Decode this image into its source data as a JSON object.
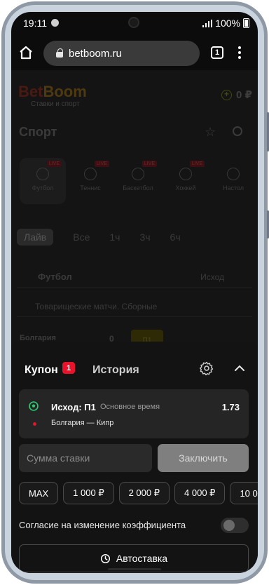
{
  "status_bar": {
    "time": "19:11",
    "battery": "100%"
  },
  "browser": {
    "url": "betboom.ru",
    "tab_count": "1"
  },
  "background_page": {
    "logo_bet": "Bet",
    "logo_boom": "Boom",
    "logo_tagline": "Ставки и спорт",
    "balance": "0 ₽",
    "section_title": "Спорт",
    "sports": [
      {
        "label": "Футбол",
        "live": "LIVE"
      },
      {
        "label": "Теннис",
        "live": "LIVE"
      },
      {
        "label": "Баскетбол",
        "live": "LIVE"
      },
      {
        "label": "Хоккей",
        "live": "LIVE"
      },
      {
        "label": "Настол"
      }
    ],
    "periods": [
      "Лайв",
      "Все",
      "1ч",
      "3ч",
      "6ч"
    ],
    "league_header": "Футбол",
    "market_select": "Исход",
    "league": "Товарищеские матчи. Сборные",
    "team": "Болгария",
    "score": "0",
    "odds_label": "П1"
  },
  "coupon": {
    "tab_coupon": "Купон",
    "badge": "1",
    "tab_history": "История",
    "bet": {
      "outcome": "Исход: П1",
      "time_label": "Основное время",
      "coefficient": "1.73",
      "match": "Болгария — Кипр"
    },
    "stake_placeholder": "Сумма ставки",
    "conclude_label": "Заключить",
    "quick_amounts": [
      "MAX",
      "1 000 ₽",
      "2 000 ₽",
      "4 000 ₽",
      "10 0"
    ],
    "agree_label": "Согласие на изменение коэффициента",
    "auto_label": "Автоставка"
  },
  "colors": {
    "accent_red": "#e8132a",
    "sheet": "#131313",
    "card": "#252525",
    "button_disabled": "#7f7f7f"
  }
}
